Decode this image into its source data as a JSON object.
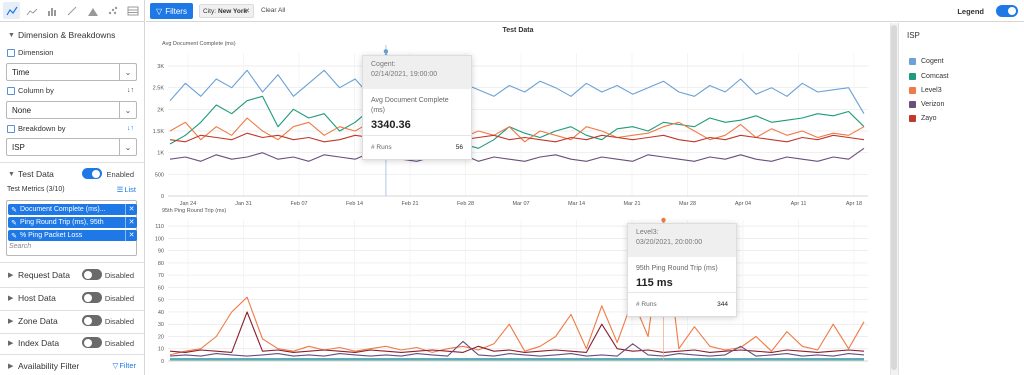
{
  "filter_bar": {
    "filters_label": "Filters",
    "city_chip_key": "City:",
    "city_chip_value": "New York",
    "clear_all": "Clear All",
    "legend_label": "Legend"
  },
  "sidebar": {
    "dimension_section": "Dimension & Breakdowns",
    "dimension_label": "Dimension",
    "dimension_value": "Time",
    "column_by_label": "Column by",
    "column_by_value": "None",
    "breakdown_label": "Breakdown by",
    "breakdown_value": "ISP",
    "test_data_label": "Test Data",
    "test_data_status": "Enabled",
    "test_metrics_label": "Test Metrics (3/10)",
    "list_label": "List",
    "metrics": [
      "Document Complete (ms)...",
      "Ping Round Trip (ms), 95th",
      "% Ping Packet Loss"
    ],
    "search_placeholder": "Search",
    "other_sections": [
      {
        "label": "Request Data",
        "status": "Disabled"
      },
      {
        "label": "Host Data",
        "status": "Disabled"
      },
      {
        "label": "Zone Data",
        "status": "Disabled"
      },
      {
        "label": "Index Data",
        "status": "Disabled"
      }
    ],
    "availability_label": "Availability Filter",
    "filter_link": "Filter"
  },
  "tooltips": {
    "top": {
      "series": "Cogent:",
      "datetime": "02/14/2021, 19:00:00",
      "metric": "Avg Document Complete (ms)",
      "value": "3340.36",
      "runs_label": "# Runs",
      "runs": "56"
    },
    "bottom": {
      "series": "Level3:",
      "datetime": "03/20/2021, 20:00:00",
      "metric": "95th Ping Round Trip (ms)",
      "value": "115 ms",
      "runs_label": "# Runs",
      "runs": "344"
    }
  },
  "legend": {
    "title": "ISP",
    "items": [
      {
        "name": "Cogent",
        "color": "#6aa1d6"
      },
      {
        "name": "Comcast",
        "color": "#1f9a7a"
      },
      {
        "name": "Level3",
        "color": "#ef7a45"
      },
      {
        "name": "Verizon",
        "color": "#6b4e7a"
      },
      {
        "name": "Zayo",
        "color": "#c0392b"
      }
    ]
  },
  "chart_data": [
    {
      "type": "line",
      "title": "Test Data",
      "ylabel": "Avg Document Complete (ms)",
      "ylim": [
        0,
        3300
      ],
      "yticks": [
        "0",
        "500",
        "1K",
        "1.5K",
        "2K",
        "2.5K",
        "3K"
      ],
      "xticks": [
        "Jan 24",
        "Jan 31",
        "Feb 07",
        "Feb 14",
        "Feb 21",
        "Feb 28",
        "Mar 07",
        "Mar 14",
        "Mar 21",
        "Mar 28",
        "Apr 04",
        "Apr 11",
        "Apr 18"
      ],
      "x_range_days": [
        0,
        88
      ],
      "series": [
        {
          "name": "Cogent",
          "color": "#6aa1d6",
          "values": [
            2200,
            2600,
            2300,
            2700,
            2500,
            2900,
            2400,
            2800,
            2300,
            2600,
            2900,
            2500,
            2700,
            2300,
            3340,
            2600,
            2400,
            2500,
            2300,
            2600,
            2450,
            2300,
            2550,
            2400,
            2650,
            2500,
            2300,
            2600,
            2400,
            2550,
            2350,
            2500,
            2650,
            2400,
            2300,
            2550,
            2400,
            2700,
            2350,
            2500,
            2300,
            2600,
            2400,
            2450,
            2500,
            1900
          ]
        },
        {
          "name": "Comcast",
          "color": "#1f9a7a",
          "values": [
            1200,
            1400,
            1700,
            2100,
            1900,
            2200,
            2300,
            1600,
            2000,
            1800,
            1900,
            1500,
            1700,
            2000,
            1900,
            1700,
            1500,
            1300,
            1500,
            1200,
            1100,
            1300,
            1600,
            1450,
            1350,
            1500,
            1600,
            1400,
            1300,
            1550,
            1600,
            1500,
            1700,
            1650,
            1600,
            1800,
            1700,
            1750,
            1850,
            1700,
            1750,
            1800,
            1900,
            1850,
            1950,
            1600
          ]
        },
        {
          "name": "Level3",
          "color": "#ef7a45",
          "values": [
            1500,
            1700,
            1300,
            1600,
            1400,
            1800,
            1500,
            1300,
            1600,
            1700,
            1400,
            1600,
            1500,
            1700,
            1400,
            1300,
            1200,
            1450,
            1600,
            1350,
            1500,
            1400,
            1600,
            1250,
            1500,
            1400,
            1300,
            1600,
            1500,
            1350,
            1400,
            1450,
            1600,
            1700,
            1500,
            1300,
            1400,
            1650,
            1350,
            1550,
            1400,
            1500,
            1350,
            1450,
            1400,
            1600
          ]
        },
        {
          "name": "Verizon",
          "color": "#6b4e7a",
          "values": [
            850,
            900,
            800,
            950,
            850,
            900,
            1000,
            850,
            900,
            800,
            950,
            900,
            850,
            1000,
            900,
            850,
            800,
            900,
            850,
            950,
            800,
            900,
            850,
            800,
            900,
            950,
            850,
            800,
            900,
            850,
            800,
            950,
            900,
            850,
            800,
            900,
            850,
            950,
            850,
            800,
            900,
            850,
            800,
            900,
            850,
            1100
          ]
        },
        {
          "name": "Zayo",
          "color": "#c0392b",
          "values": [
            1300,
            1250,
            1400,
            1350,
            1300,
            1450,
            1350,
            1400,
            1300,
            1350,
            1250,
            1300,
            1400,
            1350,
            1300,
            1200,
            1350,
            1300,
            1250,
            1300,
            1350,
            1400,
            1300,
            1350,
            1300,
            1250,
            1350,
            1300,
            1400,
            1350,
            1300,
            1350,
            1400,
            1300,
            1250,
            1350,
            1300,
            1400,
            1350,
            1300,
            1250,
            1350,
            1300,
            1400,
            1350,
            1300
          ]
        }
      ]
    },
    {
      "type": "line",
      "ylabel": "95th Ping Round Trip (ms)",
      "ylim": [
        0,
        115
      ],
      "yticks": [
        "0",
        "10",
        "20",
        "30",
        "40",
        "50",
        "60",
        "70",
        "80",
        "90",
        "100",
        "110"
      ],
      "x_range_days": [
        0,
        88
      ],
      "series": [
        {
          "name": "Level3",
          "color": "#ef7a45",
          "values": [
            5,
            8,
            10,
            20,
            40,
            52,
            18,
            10,
            8,
            12,
            9,
            11,
            8,
            10,
            12,
            9,
            11,
            7,
            10,
            12,
            9,
            14,
            30,
            8,
            12,
            20,
            38,
            10,
            45,
            15,
            50,
            20,
            115,
            10,
            28,
            12,
            9,
            11,
            20,
            8,
            24,
            12,
            9,
            30,
            10,
            32
          ]
        },
        {
          "name": "Zayo",
          "color": "#8b1e2e",
          "values": [
            8,
            7,
            9,
            8,
            7,
            40,
            8,
            9,
            7,
            8,
            9,
            8,
            7,
            9,
            8,
            7,
            8,
            9,
            8,
            7,
            12,
            8,
            9,
            7,
            8,
            9,
            8,
            7,
            30,
            10,
            8,
            9,
            7,
            8,
            9,
            7,
            8,
            9,
            8,
            7,
            9,
            8,
            7,
            8,
            9,
            8
          ]
        },
        {
          "name": "Verizon",
          "color": "#6b4e7a",
          "values": [
            4,
            5,
            4,
            6,
            5,
            4,
            5,
            6,
            4,
            5,
            4,
            6,
            5,
            4,
            5,
            4,
            6,
            5,
            4,
            16,
            5,
            4,
            6,
            5,
            4,
            5,
            6,
            4,
            5,
            4,
            14,
            5,
            4,
            6,
            5,
            4,
            5,
            12,
            4,
            5,
            6,
            4,
            5,
            4,
            6,
            5
          ]
        },
        {
          "name": "Comcast",
          "color": "#1f9a7a",
          "values": [
            1,
            1,
            1,
            1,
            1,
            1,
            1,
            1,
            1,
            1,
            1,
            1,
            1,
            1,
            1,
            1,
            1,
            1,
            1,
            1,
            1,
            1,
            1,
            1,
            1,
            1,
            1,
            1,
            1,
            1,
            1,
            1,
            1,
            1,
            1,
            1,
            1,
            1,
            1,
            1,
            1,
            1,
            1,
            1,
            1,
            1
          ]
        },
        {
          "name": "Cogent",
          "color": "#6aa1d6",
          "values": [
            2,
            2,
            2,
            2,
            2,
            2,
            2,
            2,
            2,
            2,
            2,
            2,
            2,
            2,
            2,
            2,
            2,
            2,
            2,
            2,
            2,
            2,
            2,
            2,
            2,
            2,
            2,
            2,
            2,
            2,
            2,
            2,
            2,
            2,
            2,
            2,
            2,
            2,
            2,
            2,
            2,
            2,
            2,
            2,
            2,
            2
          ]
        }
      ]
    }
  ]
}
